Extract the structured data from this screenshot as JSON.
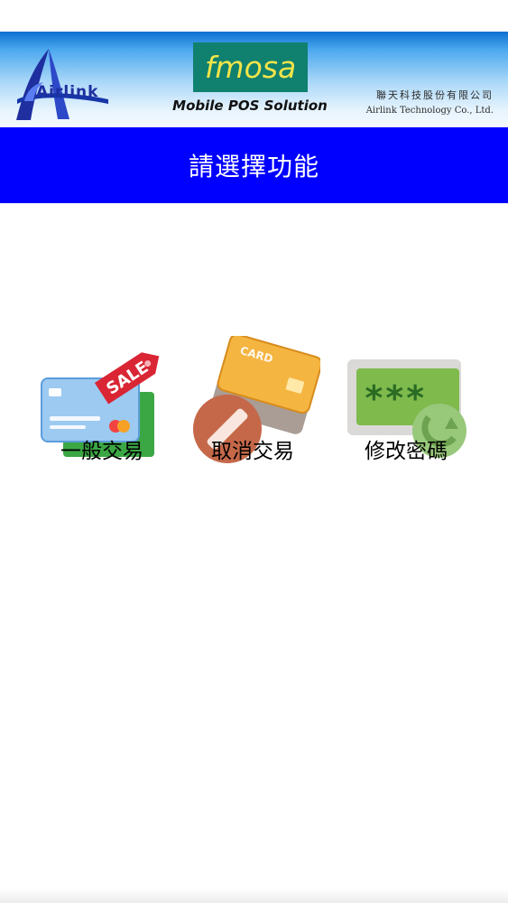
{
  "header": {
    "brand_left": "Airlink",
    "product_name": "fmosa",
    "tagline": "Mobile POS Solution",
    "company_name_cn": "聯天科技股份有限公司",
    "company_name_en": "Airlink Technology Co., Ltd.",
    "colors": {
      "banner_top": "#0b6fd0",
      "banner_bottom": "#f3f9ff",
      "fmosa_bg": "#10806f",
      "fmosa_text": "#f2e54a",
      "airlink_text": "#1f2f9f"
    }
  },
  "title_bar": {
    "text": "請選擇功能",
    "background_color": "#0000ff",
    "text_color": "#ffffff"
  },
  "functions": [
    {
      "id": "sale",
      "label": "一般交易",
      "icon": "sale-card-icon"
    },
    {
      "id": "cancel",
      "label": "取消交易",
      "icon": "cancel-card-icon"
    },
    {
      "id": "password",
      "label": "修改密碼",
      "icon": "password-change-icon"
    }
  ]
}
